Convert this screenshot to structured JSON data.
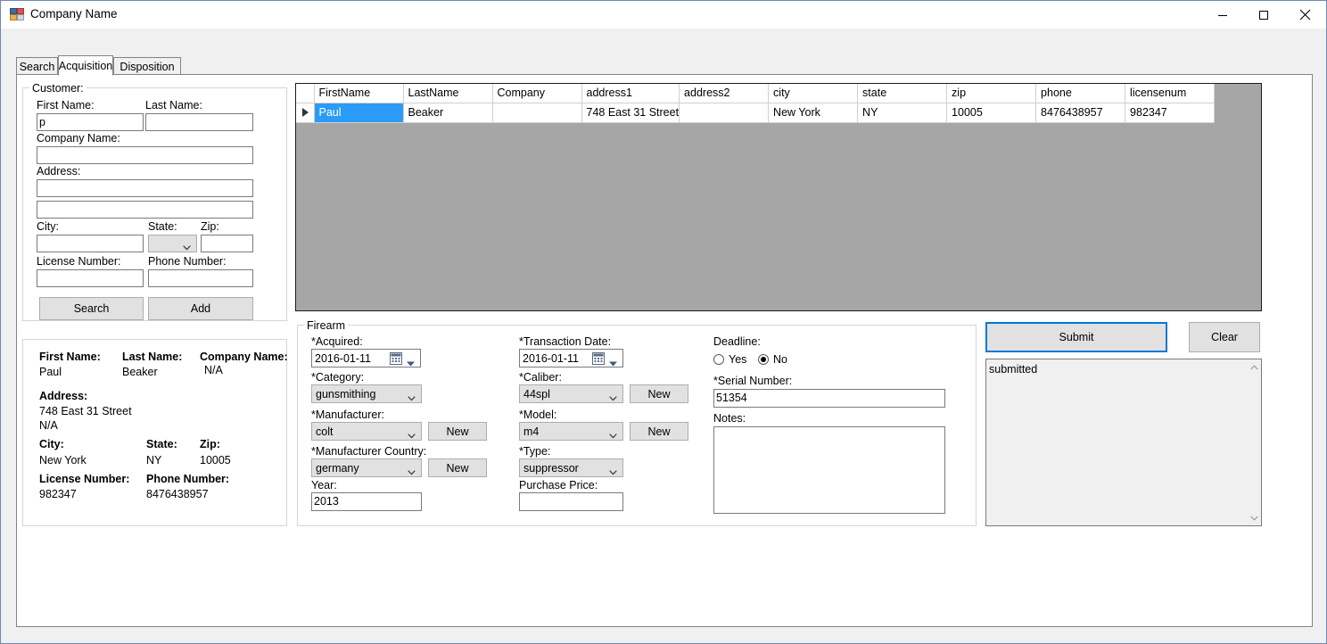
{
  "window": {
    "title": "Company Name",
    "icon": "app-window-icon",
    "controls": {
      "minimize": "Minimize",
      "maximize": "Maximize",
      "close": "Close"
    }
  },
  "tabs": [
    {
      "id": "search",
      "label": "Search",
      "active": false
    },
    {
      "id": "acquisition",
      "label": "Acquisition",
      "active": true
    },
    {
      "id": "disposition",
      "label": "Disposition",
      "active": false
    }
  ],
  "customer_group": {
    "title": "Customer:",
    "labels": {
      "first_name": "First Name:",
      "last_name": "Last Name:",
      "company_name": "Company Name:",
      "address": "Address:",
      "city": "City:",
      "state": "State:",
      "zip": "Zip:",
      "license_number": "License Number:",
      "phone_number": "Phone Number:"
    },
    "values": {
      "first_name": "p",
      "last_name": "",
      "company_name": "",
      "address1": "",
      "address2": "",
      "city": "",
      "state": "",
      "zip": "",
      "license_number": "",
      "phone_number": ""
    },
    "buttons": {
      "search": "Search",
      "add": "Add"
    }
  },
  "customer_summary": {
    "first_name_label": "First Name:",
    "first_name_value": "Paul",
    "last_name_label": "Last Name:",
    "last_name_value": "Beaker",
    "company_name_label": "Company Name:",
    "company_name_value": "N/A",
    "address_label": "Address:",
    "address_line1": "748 East 31 Street",
    "address_line2": "N/A",
    "city_label": "City:",
    "city_value": "New York",
    "state_label": "State:",
    "state_value": "NY",
    "zip_label": "Zip:",
    "zip_value": "10005",
    "license_label": "License Number:",
    "license_value": "982347",
    "phone_label": "Phone Number:",
    "phone_value": "8476438957"
  },
  "grid": {
    "columns": [
      "FirstName",
      "LastName",
      "Company",
      "address1",
      "address2",
      "city",
      "state",
      "zip",
      "phone",
      "licensenum"
    ],
    "rows": [
      {
        "selected_cell": "FirstName",
        "cells": [
          "Paul",
          "Beaker",
          "",
          "748 East 31 Street",
          "",
          "New York",
          "NY",
          "10005",
          "8476438957",
          "982347"
        ]
      }
    ]
  },
  "firearm_group": {
    "title": "Firearm",
    "labels": {
      "acquired": "*Acquired:",
      "category": "*Category:",
      "manufacturer": "*Manufacturer:",
      "manufacturer_country": "*Manufacturer Country:",
      "year": "Year:",
      "transaction_date": "*Transaction Date:",
      "caliber": "*Caliber:",
      "model": "*Model:",
      "type": "*Type:",
      "purchase_price": "Purchase Price:",
      "deadline": "Deadline:",
      "serial_number": "*Serial Number:",
      "notes": "Notes:"
    },
    "values": {
      "acquired": "2016-01-11",
      "category": "gunsmithing",
      "manufacturer": "colt",
      "manufacturer_country": "germany",
      "year": "2013",
      "transaction_date": "2016-01-11",
      "caliber": "44spl",
      "model": "m4",
      "type": "suppressor",
      "purchase_price": "",
      "serial_number": "51354",
      "notes": ""
    },
    "new_buttons": {
      "manufacturer": "New",
      "manufacturer_country": "New",
      "caliber": "New",
      "model": "New"
    },
    "deadline_options": [
      {
        "label": "Yes",
        "checked": false
      },
      {
        "label": "No",
        "checked": true
      }
    ]
  },
  "actions": {
    "submit": "Submit",
    "clear": "Clear",
    "status_text": "submitted"
  },
  "colors": {
    "accent_focus": "#0078d7",
    "grid_selection": "#2a9bf7",
    "grid_filler": "#a6a6a6",
    "window_border": "#6f89b5",
    "control_face": "#f0f0f0"
  }
}
